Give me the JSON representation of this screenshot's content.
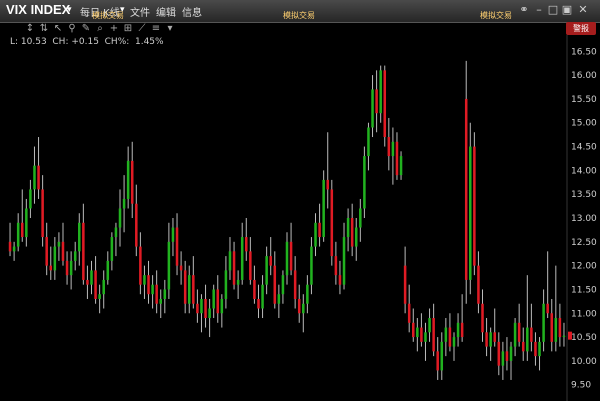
{
  "window": {
    "symbol": "VIX INDEX",
    "timeframe": "每日 K线",
    "menus": [
      "文件",
      "编辑",
      "信息"
    ],
    "sim_labels": [
      "模拟交易",
      "模拟交易",
      "模拟交易"
    ]
  },
  "readout": "L: 10.53  CH: +0.15  CH%:  1.45%",
  "warn_button": "警报",
  "colors": {
    "up": "#21b21f",
    "down": "#e01b24",
    "wick": "#bcbcbc",
    "background": "#000000"
  },
  "chart_data": {
    "type": "candlestick",
    "ylim": [
      9.2,
      16.8
    ],
    "yticks": [
      9.5,
      10.0,
      10.5,
      11.0,
      11.5,
      12.0,
      12.5,
      13.0,
      13.5,
      14.0,
      14.5,
      15.0,
      15.5,
      16.0,
      16.5
    ],
    "ytick_labels": [
      "9.50",
      "10.00",
      "10.50",
      "11.00",
      "11.50",
      "12.00",
      "12.50",
      "13.00",
      "13.50",
      "14.00",
      "14.50",
      "15.00",
      "15.50",
      "16.00",
      "16.50"
    ],
    "ohlc": [
      [
        12.5,
        12.9,
        12.2,
        12.3
      ],
      [
        12.3,
        12.5,
        12.1,
        12.4
      ],
      [
        12.4,
        13.1,
        12.3,
        12.9
      ],
      [
        12.9,
        13.6,
        12.5,
        12.6
      ],
      [
        12.6,
        13.4,
        12.4,
        13.2
      ],
      [
        13.2,
        13.8,
        13.0,
        13.6
      ],
      [
        13.6,
        14.5,
        13.3,
        14.1
      ],
      [
        14.1,
        14.7,
        13.4,
        13.6
      ],
      [
        13.6,
        13.9,
        12.4,
        12.6
      ],
      [
        12.6,
        12.9,
        11.8,
        12.0
      ],
      [
        12.0,
        12.4,
        11.7,
        11.9
      ],
      [
        11.9,
        12.6,
        11.7,
        12.4
      ],
      [
        12.4,
        12.7,
        12.1,
        12.5
      ],
      [
        12.5,
        12.9,
        12.0,
        12.1
      ],
      [
        12.1,
        12.3,
        11.6,
        11.8
      ],
      [
        11.8,
        12.3,
        11.5,
        12.1
      ],
      [
        12.1,
        12.5,
        11.9,
        12.3
      ],
      [
        12.3,
        13.1,
        12.0,
        12.9
      ],
      [
        12.9,
        13.3,
        11.6,
        11.7
      ],
      [
        11.7,
        12.0,
        11.3,
        11.6
      ],
      [
        11.6,
        12.1,
        11.4,
        11.9
      ],
      [
        11.9,
        12.2,
        11.2,
        11.3
      ],
      [
        11.3,
        11.6,
        11.0,
        11.4
      ],
      [
        11.4,
        11.9,
        11.1,
        11.7
      ],
      [
        11.7,
        12.3,
        11.6,
        12.1
      ],
      [
        12.1,
        12.7,
        11.9,
        12.6
      ],
      [
        12.6,
        12.9,
        12.2,
        12.8
      ],
      [
        12.8,
        13.6,
        12.4,
        13.2
      ],
      [
        13.2,
        13.9,
        12.7,
        13.4
      ],
      [
        13.4,
        14.5,
        13.2,
        14.2
      ],
      [
        14.2,
        14.6,
        13.0,
        13.3
      ],
      [
        13.3,
        13.7,
        12.2,
        12.4
      ],
      [
        12.4,
        12.7,
        11.4,
        11.6
      ],
      [
        11.6,
        12.0,
        11.3,
        11.8
      ],
      [
        11.8,
        12.1,
        11.2,
        11.4
      ],
      [
        11.4,
        11.8,
        11.1,
        11.6
      ],
      [
        11.6,
        11.9,
        11.0,
        11.2
      ],
      [
        11.2,
        11.5,
        10.9,
        11.3
      ],
      [
        11.3,
        11.7,
        11.0,
        11.5
      ],
      [
        11.5,
        12.9,
        11.3,
        12.5
      ],
      [
        12.5,
        13.0,
        12.2,
        12.8
      ],
      [
        12.8,
        13.1,
        11.8,
        12.0
      ],
      [
        12.0,
        12.3,
        11.6,
        11.9
      ],
      [
        11.9,
        12.1,
        11.0,
        11.2
      ],
      [
        11.2,
        12.0,
        11.0,
        11.8
      ],
      [
        11.8,
        12.2,
        11.1,
        11.2
      ],
      [
        11.2,
        11.5,
        10.8,
        11.0
      ],
      [
        11.0,
        11.4,
        10.6,
        11.3
      ],
      [
        11.3,
        11.6,
        10.7,
        10.9
      ],
      [
        10.9,
        11.3,
        10.5,
        11.1
      ],
      [
        11.1,
        11.6,
        10.9,
        11.5
      ],
      [
        11.5,
        11.8,
        10.8,
        11.0
      ],
      [
        11.0,
        11.4,
        10.7,
        11.3
      ],
      [
        11.3,
        12.2,
        11.1,
        11.9
      ],
      [
        11.9,
        12.6,
        11.7,
        12.3
      ],
      [
        12.3,
        12.5,
        11.5,
        11.6
      ],
      [
        11.6,
        11.9,
        11.3,
        11.7
      ],
      [
        11.7,
        12.9,
        11.6,
        12.6
      ],
      [
        12.6,
        13.0,
        12.1,
        12.3
      ],
      [
        12.3,
        12.6,
        11.6,
        11.7
      ],
      [
        11.7,
        12.0,
        11.2,
        11.3
      ],
      [
        11.3,
        11.6,
        10.9,
        11.1
      ],
      [
        11.1,
        11.8,
        10.9,
        11.6
      ],
      [
        11.6,
        12.4,
        11.4,
        12.2
      ],
      [
        12.2,
        12.6,
        11.8,
        12.0
      ],
      [
        12.0,
        12.3,
        11.1,
        11.2
      ],
      [
        11.2,
        11.6,
        10.9,
        11.4
      ],
      [
        11.4,
        11.9,
        11.2,
        11.8
      ],
      [
        11.8,
        12.7,
        11.6,
        12.5
      ],
      [
        12.5,
        12.9,
        11.8,
        11.9
      ],
      [
        11.9,
        12.2,
        11.1,
        11.3
      ],
      [
        11.3,
        11.6,
        10.8,
        11.0
      ],
      [
        11.0,
        11.4,
        10.6,
        11.2
      ],
      [
        11.2,
        11.8,
        11.0,
        11.6
      ],
      [
        11.6,
        12.6,
        11.4,
        12.4
      ],
      [
        12.4,
        13.1,
        12.2,
        12.9
      ],
      [
        12.9,
        13.3,
        12.4,
        12.6
      ],
      [
        12.6,
        14.0,
        12.5,
        13.8
      ],
      [
        13.8,
        14.8,
        13.2,
        13.6
      ],
      [
        13.6,
        13.8,
        12.0,
        12.2
      ],
      [
        12.2,
        12.5,
        11.6,
        11.8
      ],
      [
        11.8,
        12.1,
        11.4,
        11.6
      ],
      [
        11.6,
        12.9,
        11.5,
        12.6
      ],
      [
        12.6,
        13.2,
        12.3,
        13.0
      ],
      [
        13.0,
        13.3,
        12.2,
        12.4
      ],
      [
        12.4,
        13.0,
        12.1,
        12.8
      ],
      [
        12.8,
        13.4,
        12.5,
        13.2
      ],
      [
        13.2,
        14.5,
        13.0,
        14.3
      ],
      [
        14.3,
        15.0,
        14.0,
        14.9
      ],
      [
        14.9,
        16.0,
        14.7,
        15.7
      ],
      [
        15.7,
        16.1,
        14.8,
        15.2
      ],
      [
        15.2,
        16.2,
        15.0,
        16.1
      ],
      [
        16.1,
        16.2,
        14.5,
        14.7
      ],
      [
        14.7,
        15.1,
        14.0,
        14.3
      ],
      [
        14.3,
        14.9,
        13.7,
        14.6
      ],
      [
        14.6,
        14.8,
        13.8,
        13.9
      ],
      [
        13.9,
        14.4,
        13.8,
        14.3
      ],
      [
        12.0,
        12.4,
        11.0,
        11.2
      ],
      [
        11.2,
        11.6,
        10.6,
        10.8
      ],
      [
        10.8,
        11.1,
        10.4,
        10.5
      ],
      [
        10.5,
        10.9,
        10.2,
        10.7
      ],
      [
        10.7,
        11.0,
        10.3,
        10.4
      ],
      [
        10.4,
        10.8,
        10.0,
        10.6
      ],
      [
        10.6,
        11.1,
        10.4,
        10.9
      ],
      [
        10.9,
        11.2,
        10.1,
        10.2
      ],
      [
        10.2,
        10.5,
        9.6,
        9.8
      ],
      [
        9.8,
        10.6,
        9.6,
        10.4
      ],
      [
        10.4,
        10.9,
        10.1,
        10.7
      ],
      [
        10.7,
        11.0,
        10.2,
        10.3
      ],
      [
        10.3,
        10.6,
        10.0,
        10.5
      ],
      [
        10.5,
        11.0,
        10.3,
        10.8
      ],
      [
        10.8,
        11.4,
        10.4,
        10.5
      ],
      [
        15.5,
        16.3,
        11.2,
        11.7
      ],
      [
        11.7,
        15.0,
        11.4,
        14.5
      ],
      [
        14.5,
        14.8,
        11.8,
        12.0
      ],
      [
        12.0,
        12.3,
        11.0,
        11.2
      ],
      [
        11.2,
        11.5,
        10.4,
        10.6
      ],
      [
        10.6,
        10.9,
        10.1,
        10.3
      ],
      [
        10.3,
        10.7,
        10.0,
        10.6
      ],
      [
        10.6,
        11.1,
        10.3,
        10.4
      ],
      [
        10.4,
        10.6,
        9.7,
        9.9
      ],
      [
        9.9,
        10.4,
        9.6,
        10.2
      ],
      [
        10.2,
        10.5,
        9.8,
        10.0
      ],
      [
        10.0,
        10.4,
        9.6,
        10.3
      ],
      [
        10.3,
        10.9,
        10.1,
        10.8
      ],
      [
        10.8,
        11.2,
        10.3,
        10.4
      ],
      [
        10.4,
        10.7,
        10.0,
        10.2
      ],
      [
        10.2,
        11.8,
        10.0,
        10.7
      ],
      [
        10.7,
        11.2,
        10.2,
        10.4
      ],
      [
        10.4,
        10.6,
        9.9,
        10.1
      ],
      [
        10.1,
        10.5,
        9.8,
        10.4
      ],
      [
        10.4,
        11.5,
        10.2,
        11.2
      ],
      [
        11.2,
        12.3,
        10.9,
        11.0
      ],
      [
        11.0,
        11.3,
        10.2,
        10.4
      ],
      [
        10.4,
        12.0,
        10.2,
        10.9
      ],
      [
        10.9,
        11.2,
        10.3,
        10.5
      ],
      [
        10.5,
        10.8,
        10.3,
        10.53
      ]
    ]
  }
}
